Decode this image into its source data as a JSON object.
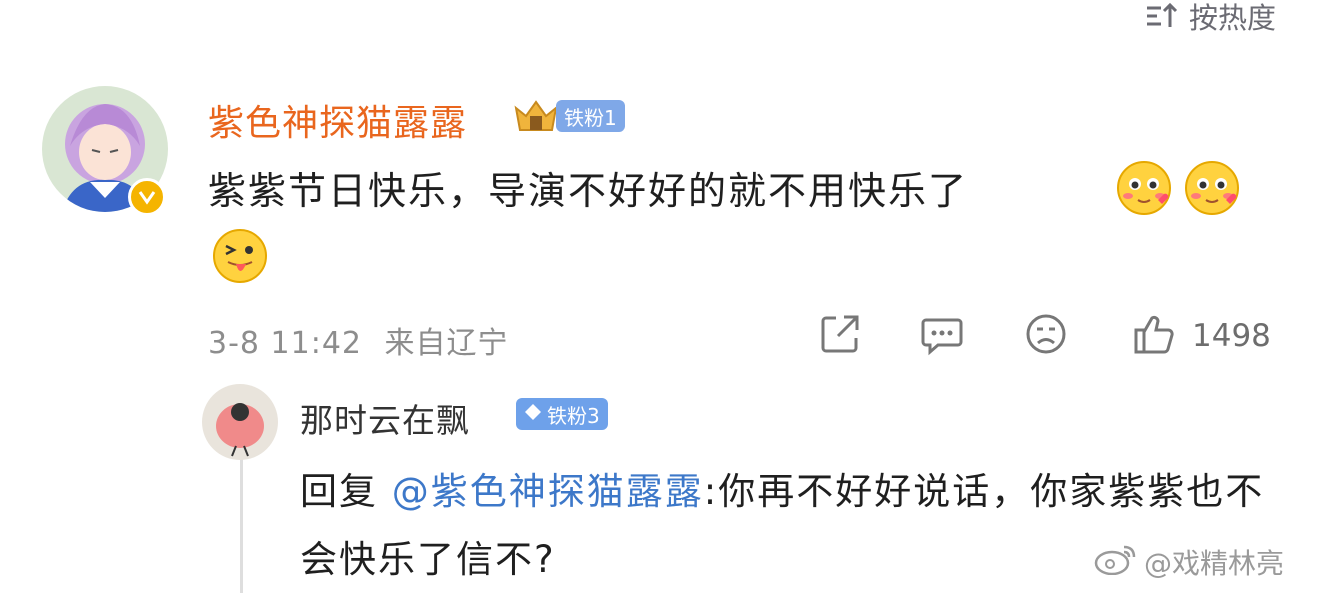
{
  "sort": {
    "label": "按热度"
  },
  "main_comment": {
    "username": "紫色神探猫露露",
    "fan_badge": "铁粉1",
    "text": "紫紫节日快乐，导演不好好的就不用快乐了",
    "timestamp": "3-8 11:42",
    "location": "来自辽宁",
    "like_count": "1498",
    "icons": [
      "share-icon",
      "comment-icon",
      "dislike-face-icon",
      "thumbs-up-icon"
    ]
  },
  "reply": {
    "username": "那时云在飘",
    "fan_badge": "铁粉3",
    "prefix": "回复 ",
    "mention": "@紫色神探猫露露",
    "text": ":你再不好好说话，你家紫紫也不会快乐了信不?"
  },
  "watermark": {
    "text": "@戏精林亮"
  },
  "colors": {
    "username_orange": "#e9661e",
    "mention_blue": "#3d78c9",
    "badge_blue": "#7fa8e8",
    "meta_gray": "#8d8d8d"
  }
}
